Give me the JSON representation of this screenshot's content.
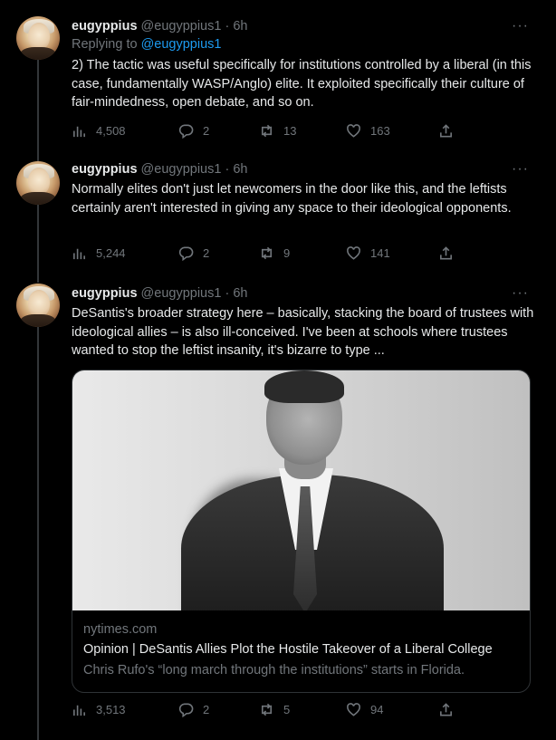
{
  "tweets": [
    {
      "name": "eugyppius",
      "handle": "@eugyppius1",
      "time": "· 6h",
      "more": "···",
      "replying_label": "Replying to",
      "replying_to": "@eugyppius1",
      "text": "2) The tactic was useful specifically for institutions controlled by a liberal (in this case, fundamentally WASP/Anglo) elite. It exploited specifically their culture of fair-mindedness, open debate, and so on.",
      "views": "4,508",
      "replies": "2",
      "retweets": "13",
      "likes": "163"
    },
    {
      "name": "eugyppius",
      "handle": "@eugyppius1",
      "time": "· 6h",
      "more": "···",
      "text": "Normally elites don't just let newcomers in the door like this, and the leftists certainly aren't interested in giving any space to their ideological opponents.",
      "views": "5,244",
      "replies": "2",
      "retweets": "9",
      "likes": "141"
    },
    {
      "name": "eugyppius",
      "handle": "@eugyppius1",
      "time": "· 6h",
      "more": "···",
      "text": "DeSantis's broader strategy here – basically, stacking the board of trustees with ideological allies – is also ill-conceived. I've been at schools where trustees wanted to stop the leftist insanity, it's bizarre to type ...",
      "views": "3,513",
      "replies": "2",
      "retweets": "5",
      "likes": "94",
      "card": {
        "domain": "nytimes.com",
        "title": "Opinion | DeSantis Allies Plot the Hostile Takeover of a Liberal College",
        "description": "Chris Rufo's “long march through the institutions” starts in Florida."
      }
    }
  ],
  "icons": {
    "views": "bar-chart-icon",
    "reply": "comment-icon",
    "retweet": "retweet-icon",
    "like": "heart-icon",
    "share": "share-icon"
  },
  "colors": {
    "background": "#000000",
    "text": "#e7e9ea",
    "muted": "#71767b",
    "link": "#1d9bf0"
  }
}
